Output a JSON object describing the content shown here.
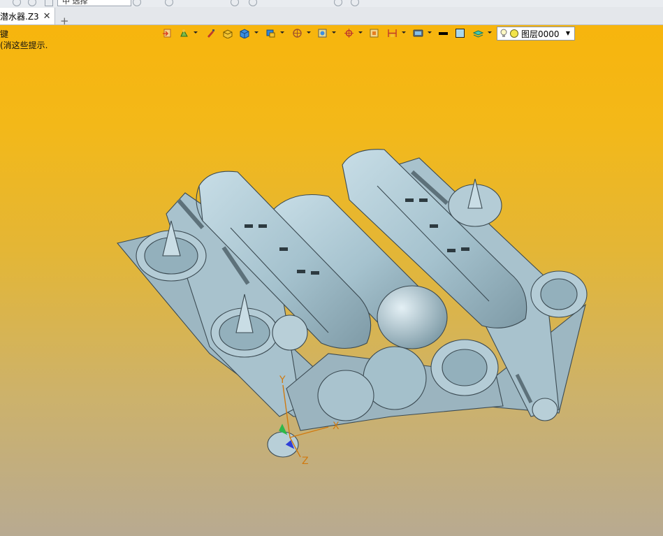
{
  "toolbar": {
    "filter_value": "中  选择"
  },
  "tab": {
    "label": "潜水器.Z3",
    "close": "✕",
    "add": "+"
  },
  "hints": [
    "键",
    "(消这些提示."
  ],
  "layer": {
    "name": "图层0000"
  },
  "axes": {
    "x": "X",
    "y": "Y",
    "z": "Z"
  },
  "colors": {
    "bg_top": "#f7b50d",
    "bg_bottom": "#b8aa91",
    "model": "#a9c6d3",
    "edge": "#3b4a52"
  }
}
